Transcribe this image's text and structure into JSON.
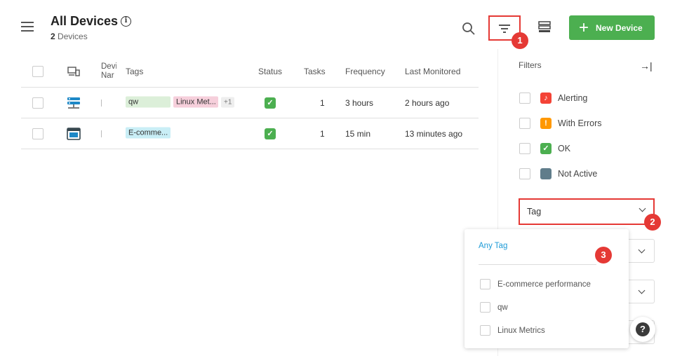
{
  "header": {
    "title": "All Devices",
    "device_count": "2",
    "device_count_label": "Devices",
    "new_device_label": "New Device",
    "annotation_1": "1",
    "annotation_2": "2",
    "annotation_3": "3"
  },
  "table": {
    "columns": {
      "device_name": "Devic Nar",
      "tags": "Tags",
      "status": "Status",
      "tasks": "Tasks",
      "frequency": "Frequency",
      "last_monitored": "Last Monitored"
    },
    "rows": [
      {
        "icon": "server-icon",
        "tags": [
          "qw",
          "Linux Met..."
        ],
        "more_tags": "+1",
        "status": "ok",
        "tasks": "1",
        "frequency": "3 hours",
        "last_monitored": "2 hours ago"
      },
      {
        "icon": "browser-window-icon",
        "tags": [
          "E-comme..."
        ],
        "status": "ok",
        "tasks": "1",
        "frequency": "15 min",
        "last_monitored": "13 minutes ago"
      }
    ]
  },
  "filters": {
    "label": "Filters",
    "status_options": [
      {
        "label": "Alerting",
        "color": "#f44336",
        "icon": "bell-icon"
      },
      {
        "label": "With Errors",
        "color": "#ff9800",
        "icon": "exclamation-icon"
      },
      {
        "label": "OK",
        "color": "#4caf50",
        "icon": "check-icon"
      },
      {
        "label": "Not Active",
        "color": "#607d8b",
        "icon": "square-icon"
      }
    ],
    "tag_select": {
      "value": "Tag",
      "dropdown": {
        "any_tag": "Any Tag",
        "options": [
          "E-commerce performance",
          "qw",
          "Linux Metrics"
        ]
      }
    }
  },
  "colors": {
    "accent_green": "#4caf50",
    "highlight_red": "#e53935",
    "link_blue": "#1e9bd7"
  }
}
